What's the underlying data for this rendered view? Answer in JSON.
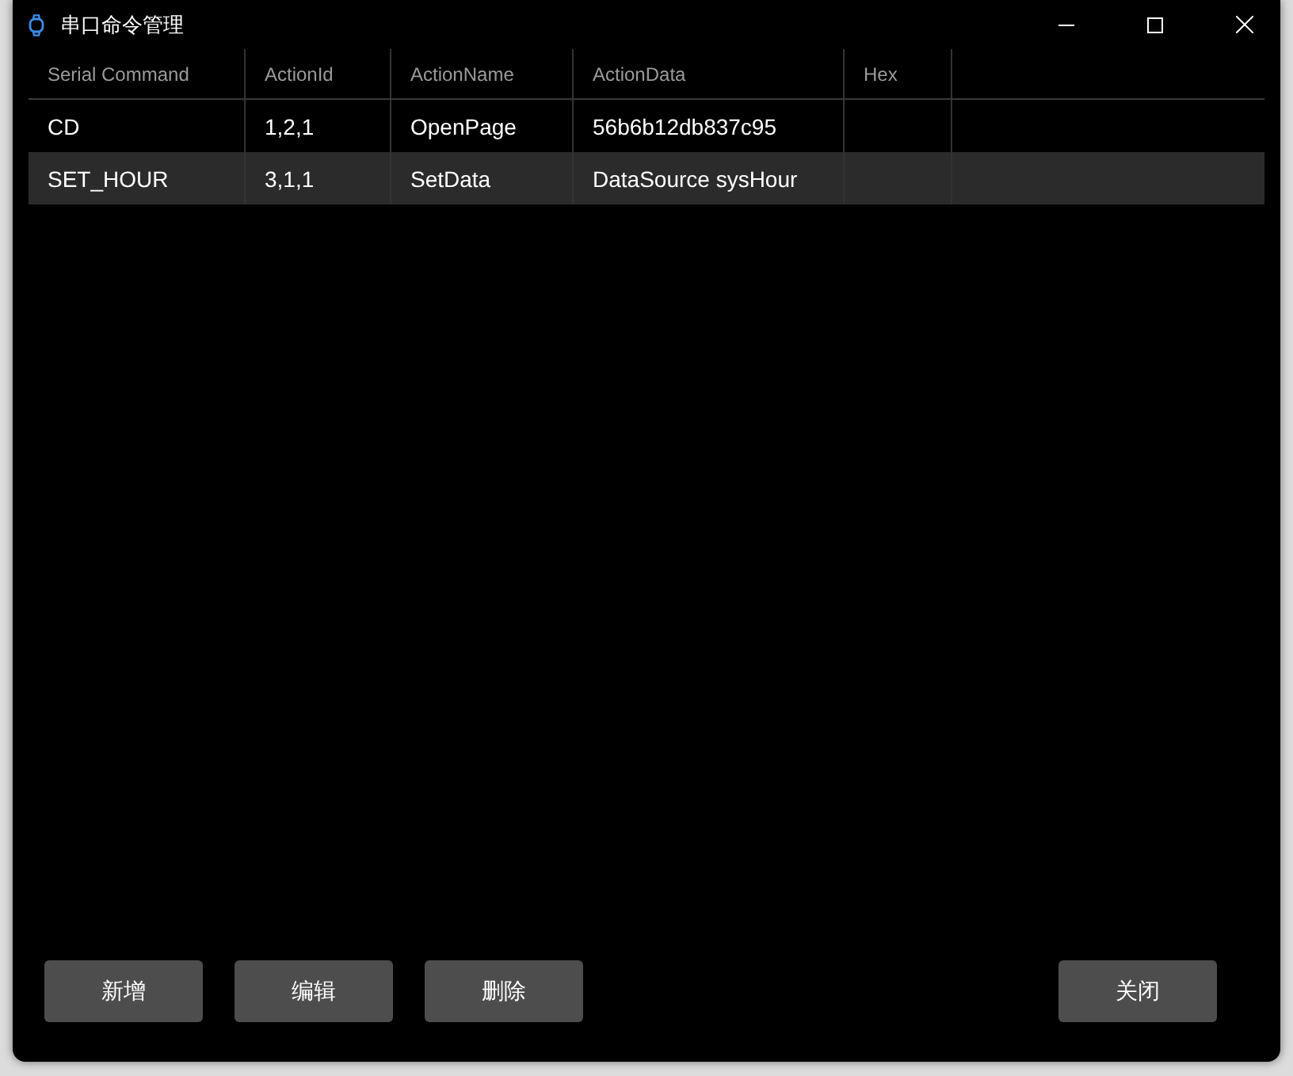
{
  "window": {
    "title": "串口命令管理"
  },
  "table": {
    "columns": [
      "Serial Command",
      "ActionId",
      "ActionName",
      "ActionData",
      "Hex"
    ],
    "rows": [
      {
        "cells": [
          "CD",
          "1,2,1",
          "OpenPage",
          "56b6b12db837c95",
          ""
        ],
        "selected": false
      },
      {
        "cells": [
          "SET_HOUR",
          "3,1,1",
          "SetData",
          "DataSource sysHour",
          ""
        ],
        "selected": true
      }
    ]
  },
  "buttons": [
    {
      "label": "新增",
      "kind": "left"
    },
    {
      "label": "编辑",
      "kind": "left"
    },
    {
      "label": "删除",
      "kind": "left"
    },
    {
      "label": "关闭",
      "kind": "right"
    }
  ]
}
